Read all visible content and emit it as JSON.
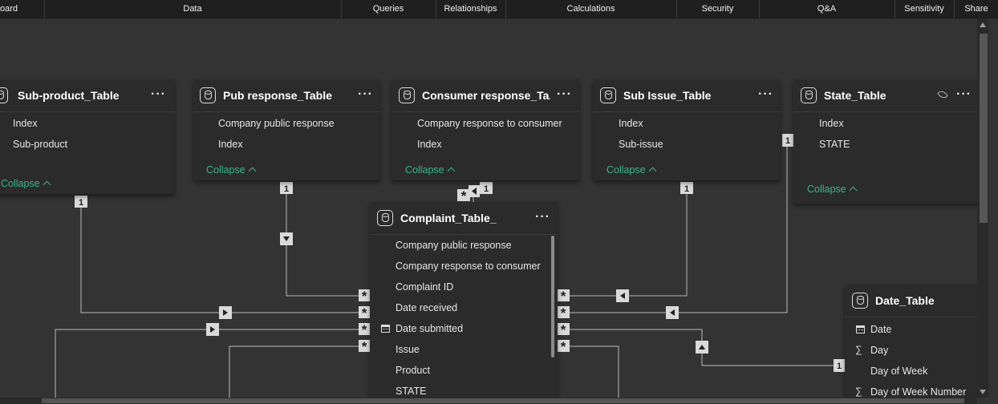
{
  "ribbon": {
    "groups": [
      "oard",
      "Data",
      "Queries",
      "Relationships",
      "Calculations",
      "Security",
      "Q&A",
      "Sensitivity",
      "Share"
    ]
  },
  "tables": {
    "subproduct": {
      "title": "Sub-product_Table",
      "fields": [
        "Index",
        "Sub-product"
      ],
      "collapse": "Collapse"
    },
    "pubresponse": {
      "title": "Pub response_Table",
      "fields": [
        "Company public response",
        "Index"
      ],
      "collapse": "Collapse"
    },
    "consumer": {
      "title": "Consumer response_Ta...",
      "fields": [
        "Company response to consumer",
        "Index"
      ],
      "collapse": "Collapse"
    },
    "subissue": {
      "title": "Sub Issue_Table",
      "fields": [
        "Index",
        "Sub-issue"
      ],
      "collapse": "Collapse"
    },
    "state": {
      "title": "State_Table",
      "fields": [
        "Index",
        "STATE"
      ],
      "collapse": "Collapse"
    },
    "complaint": {
      "title": "Complaint_Table_",
      "fields": [
        "Company public response",
        "Company response to consumer",
        "Complaint ID",
        "Date received",
        "Date submitted",
        "Issue",
        "Product",
        "STATE"
      ]
    },
    "date": {
      "title": "Date_Table",
      "fields": [
        "Date",
        "Day",
        "Day of Week",
        "Day of Week Number"
      ]
    }
  },
  "markers": {
    "one": "1",
    "many": "*"
  },
  "menu_glyph": "···",
  "icons": {
    "table": "table-icon",
    "more": "more-options-icon",
    "visibility": "eye-icon",
    "calendar": "calendar-icon",
    "sum": "sigma-icon"
  }
}
